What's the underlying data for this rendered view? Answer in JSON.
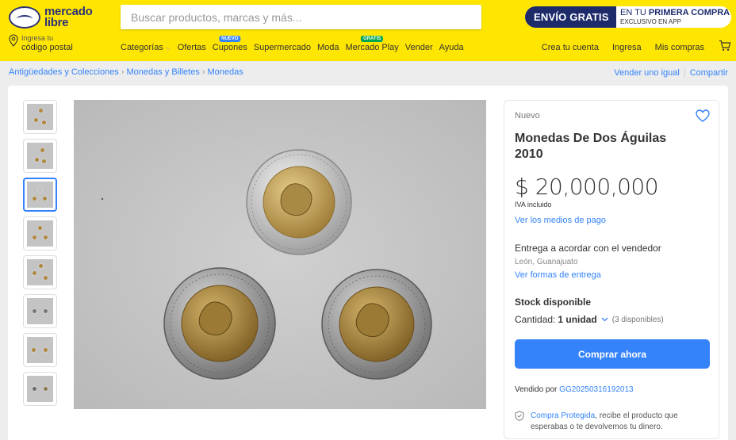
{
  "colors": {
    "header_bg": "#ffe600",
    "brand_blue": "#2d3277",
    "accent": "#3483fa",
    "promo_dark": "#1d2b6b"
  },
  "header": {
    "logo_line1": "mercado",
    "logo_line2": "libre",
    "search_placeholder": "Buscar productos, marcas y más...",
    "search_icon": "search-icon",
    "promo_left": "ENVÍO GRATIS",
    "promo_right_pre": "EN TU ",
    "promo_right_bold": "PRIMERA COMPRA",
    "promo_right_small": "EXCLUSIVO EN APP",
    "location_line1": "Ingresa tu",
    "location_line2": "código postal",
    "location_icon": "location-pin-icon",
    "nav": [
      {
        "label": "Categorías",
        "chevron": "⌵"
      },
      {
        "label": "Ofertas"
      },
      {
        "label": "Cupones",
        "badge": "NUEVO",
        "badge_color": "#3483fa"
      },
      {
        "label": "Supermercado"
      },
      {
        "label": "Moda"
      },
      {
        "label": "Mercado Play",
        "badge": "GRATIS",
        "badge_color": "#00a650"
      },
      {
        "label": "Vender"
      },
      {
        "label": "Ayuda"
      }
    ],
    "right_nav": [
      "Crea tu cuenta",
      "Ingresa",
      "Mis compras"
    ],
    "cart_icon": "cart-icon"
  },
  "breadcrumb": {
    "items": [
      "Antigüedades y Colecciones",
      "Monedas y Billetes",
      "Monedas"
    ],
    "separator": "›",
    "sell_similar": "Vender uno igual",
    "divider": "|",
    "share": "Compartir"
  },
  "gallery": {
    "thumbnail_count": 8,
    "active_index": 2
  },
  "product": {
    "condition": "Nuevo",
    "favorite_icon": "heart-icon",
    "title": "Monedas De Dos Águilas 2010",
    "price": "$ 20,000,000",
    "tax_note": "IVA incluido",
    "payment_link": "Ver los medios de pago",
    "shipping_title": "Entrega a acordar con el vendedor",
    "shipping_location": "León, Guanajuato",
    "shipping_link": "Ver formas de entrega",
    "stock_label": "Stock disponible",
    "quantity_label": "Cantidad:",
    "quantity_value": "1 unidad",
    "quantity_available": "(3 disponibles)",
    "buy_button": "Comprar ahora",
    "seller_prefix": "Vendido por ",
    "seller_name": "GG20250316192013",
    "protection_name": "Compra Protegida",
    "protection_text": ", recibe el producto que esperabas o te devolvemos tu dinero.",
    "protection_icon": "shield-icon"
  }
}
